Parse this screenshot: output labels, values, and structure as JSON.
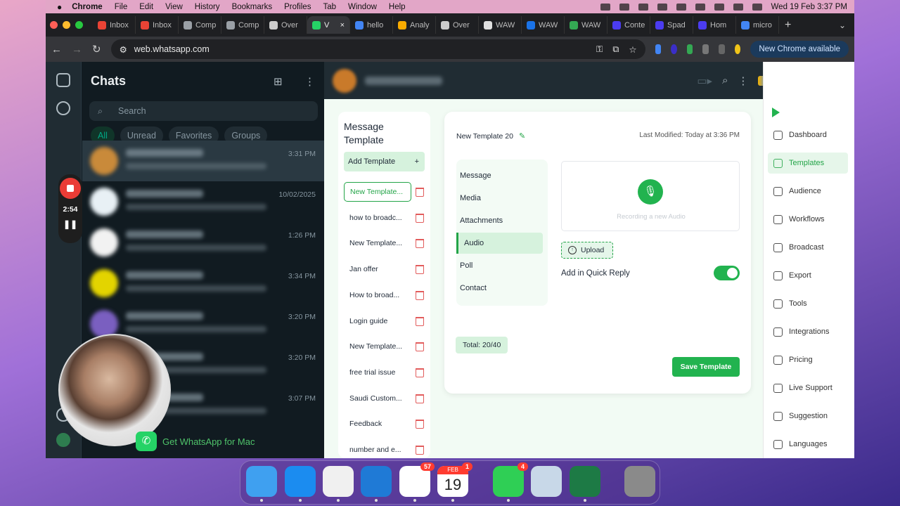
{
  "menubar": {
    "app": "Chrome",
    "items": [
      "File",
      "Edit",
      "View",
      "History",
      "Bookmarks",
      "Profiles",
      "Tab",
      "Window",
      "Help"
    ],
    "datetime": "Wed 19 Feb  3:37 PM"
  },
  "tabs": [
    {
      "label": "Inbox",
      "icon": "gmail-icon",
      "color": "#ea4335"
    },
    {
      "label": "Inbox",
      "icon": "gmail-icon",
      "color": "#ea4335"
    },
    {
      "label": "Comp",
      "icon": "globe-icon",
      "color": "#9aa0a6"
    },
    {
      "label": "Comp",
      "icon": "globe-icon",
      "color": "#9aa0a6"
    },
    {
      "label": "Over",
      "icon": "car-icon",
      "color": "#cccccc"
    },
    {
      "label": "V",
      "icon": "whatsapp-icon",
      "color": "#25d366",
      "active": true
    },
    {
      "label": "hello",
      "icon": "google-icon",
      "color": "#4285f4"
    },
    {
      "label": "Analy",
      "icon": "analytics-icon",
      "color": "#f9ab00"
    },
    {
      "label": "Over",
      "icon": "car-icon",
      "color": "#cccccc"
    },
    {
      "label": "WAW",
      "icon": "image-icon",
      "color": "#e0e0e0"
    },
    {
      "label": "WAW",
      "icon": "drive-icon",
      "color": "#1a73e8"
    },
    {
      "label": "WAW",
      "icon": "ext-icon",
      "color": "#34a853"
    },
    {
      "label": "Conte",
      "icon": "docs-icon",
      "color": "#4b3cf0"
    },
    {
      "label": "Spad",
      "icon": "docs-icon",
      "color": "#4b3cf0"
    },
    {
      "label": "Hom",
      "icon": "docs-icon",
      "color": "#4b3cf0"
    },
    {
      "label": "micro",
      "icon": "google-icon",
      "color": "#4285f4"
    }
  ],
  "address": {
    "url": "web.whatsapp.com",
    "new_chrome": "New Chrome available"
  },
  "whatsapp": {
    "title": "Chats",
    "search_placeholder": "Search",
    "filters": [
      "All",
      "Unread",
      "Favorites",
      "Groups"
    ],
    "chats": [
      {
        "time": "3:31 PM",
        "avatar_color": "#c98a3a"
      },
      {
        "time": "10/02/2025",
        "avatar_color": "#e8f0f5"
      },
      {
        "time": "1:26 PM",
        "avatar_color": "#f2f2f2"
      },
      {
        "time": "3:34 PM",
        "avatar_color": "#e3d400"
      },
      {
        "time": "3:20 PM",
        "avatar_color": "#7a5fc0"
      },
      {
        "time": "3:20 PM",
        "avatar_color": "#7a5fc0"
      },
      {
        "time": "3:07 PM",
        "avatar_color": "#555555"
      }
    ],
    "recorder_time": "2:54",
    "get_mac": "Get WhatsApp for Mac"
  },
  "templates": {
    "title": "Message Template",
    "add_label": "Add Template",
    "items": [
      "New Template...",
      "how to broadc...",
      "New Template...",
      "Jan offer",
      "How to broad...",
      "Login guide",
      "New Template...",
      "free trial issue",
      "Saudi Custom...",
      "Feedback",
      "number and e..."
    ]
  },
  "editor": {
    "name": "New Template 20",
    "last_modified": "Last Modified: Today at 3:36 PM",
    "sections": [
      "Message",
      "Media",
      "Attachments",
      "Audio",
      "Poll",
      "Contact"
    ],
    "recording_label": "Recording a new Audio",
    "upload_label": "Upload",
    "quick_reply_label": "Add in Quick Reply",
    "quick_reply_on": true,
    "total": "Total: 20/40",
    "save_label": "Save Template"
  },
  "side_nav": {
    "items": [
      "Dashboard",
      "Templates",
      "Audience",
      "Workflows",
      "Broadcast",
      "Export",
      "Tools",
      "Integrations",
      "Pricing",
      "Live Support",
      "Suggestion",
      "Languages"
    ]
  },
  "dock": {
    "apps": [
      {
        "name": "finder",
        "color": "#3fa0f0"
      },
      {
        "name": "safari",
        "color": "#1b8cf0"
      },
      {
        "name": "chrome",
        "color": "#f0f0f0"
      },
      {
        "name": "vscode",
        "color": "#1f7ad6"
      },
      {
        "name": "slack",
        "color": "#ffffff",
        "badge": "57"
      },
      {
        "name": "calendar",
        "color": "#ffffff",
        "badge": "1",
        "month": "FEB",
        "day": "19"
      },
      {
        "name": "facetime",
        "color": "#2fcf55",
        "badge": "4"
      },
      {
        "name": "preview",
        "color": "#c8d8e8"
      },
      {
        "name": "excel",
        "color": "#1d7a45"
      },
      {
        "name": "trash",
        "color": "#8a8a8a"
      }
    ]
  }
}
